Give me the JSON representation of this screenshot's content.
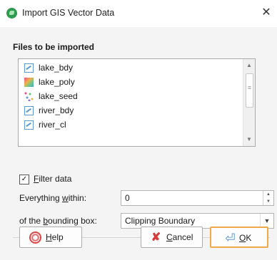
{
  "window": {
    "title": "Import GIS Vector Data",
    "close_glyph": "✕"
  },
  "files": {
    "section_label": "Files to be imported",
    "items": [
      {
        "label": "lake_bdy",
        "icon": "polyline-icon"
      },
      {
        "label": "lake_poly",
        "icon": "polygon-icon"
      },
      {
        "label": "lake_seed",
        "icon": "points-icon"
      },
      {
        "label": "river_bdy",
        "icon": "polyline-icon"
      },
      {
        "label": "river_cl",
        "icon": "polyline-icon"
      }
    ]
  },
  "filter": {
    "checked": true,
    "check_glyph": "✓",
    "label_mnemonic": "F",
    "label_rest": "ilter data",
    "within": {
      "label_pre": "Everything ",
      "label_mnemonic": "w",
      "label_post": "ithin:",
      "value": "0"
    },
    "bounding": {
      "label_pre": "of the ",
      "label_mnemonic": "b",
      "label_post": "ounding box:",
      "value": "Clipping Boundary"
    }
  },
  "buttons": {
    "help": {
      "mnemonic": "H",
      "rest": "elp"
    },
    "cancel": {
      "mnemonic": "C",
      "rest": "ancel"
    },
    "ok": {
      "mnemonic": "O",
      "rest": "K"
    }
  },
  "colors": {
    "accent_ok_border": "#f0a94a",
    "title_icon": "#2e9a4d",
    "cancel_icon": "#d93a3a"
  }
}
